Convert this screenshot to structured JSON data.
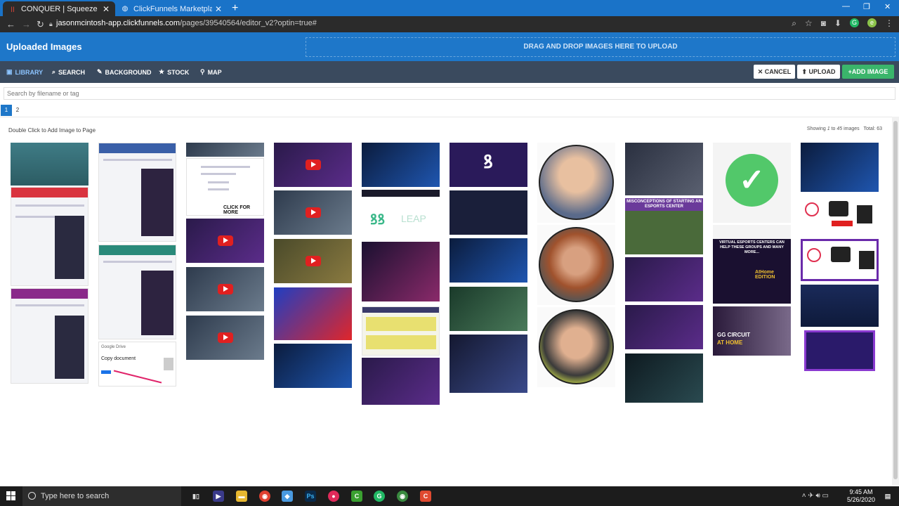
{
  "browser": {
    "tabs": [
      {
        "title": "CONQUER | Squeeze Page Funne",
        "favicon": "clickfunnels-icon",
        "active": true
      },
      {
        "title": "ClickFunnels Marketplace",
        "favicon": "globe-icon",
        "active": false
      }
    ],
    "url_host": "jasonmcintosh-app.clickfunnels.com",
    "url_path": "/pages/39540564/editor_v2?optin=true#"
  },
  "header": {
    "title": "Uploaded Images",
    "dropzone": "DRAG AND DROP IMAGES HERE TO UPLOAD"
  },
  "toolbar": {
    "tabs": [
      {
        "label": "LIBRARY",
        "icon": "images-icon"
      },
      {
        "label": "SEARCH",
        "icon": "search-icon"
      },
      {
        "label": "BACKGROUND",
        "icon": "brush-icon"
      },
      {
        "label": "STOCK",
        "icon": "star-icon"
      },
      {
        "label": "MAP",
        "icon": "map-pin-icon"
      }
    ],
    "cancel": "CANCEL",
    "upload": "UPLOAD",
    "add_image": "ADD IMAGE"
  },
  "search": {
    "placeholder": "Search by filename or tag"
  },
  "pager": {
    "pages": [
      "1",
      "2"
    ],
    "current": "1"
  },
  "gallery": {
    "hint": "Double Click to Add Image to Page",
    "showing_prefix": "Showing ",
    "range_start": "1",
    "range_to": " to ",
    "range_end": "45",
    "showing_suffix": " images",
    "total_label": "Total: ",
    "total": "63"
  },
  "thumb_labels": {
    "click_for_more": "CLICK FOR MORE",
    "misconceptions": "MISCONCEPTIONS OF STARTING AN ESPORTS CENTER",
    "virtual": "VIRTUAL ESPORTS CENTERS CAN HELP THESE GROUPS AND MANY MORE...",
    "gg_circuit": "GG CIRCUIT",
    "at_home": "AT HOME",
    "copy_document": "Copy document",
    "google_drive": "Google Drive",
    "leap": "LEAP",
    "athome_edition": "AtHome EDITION"
  },
  "taskbar": {
    "search": "Type here to search",
    "time": "9:45 AM",
    "date": "5/26/2020"
  }
}
